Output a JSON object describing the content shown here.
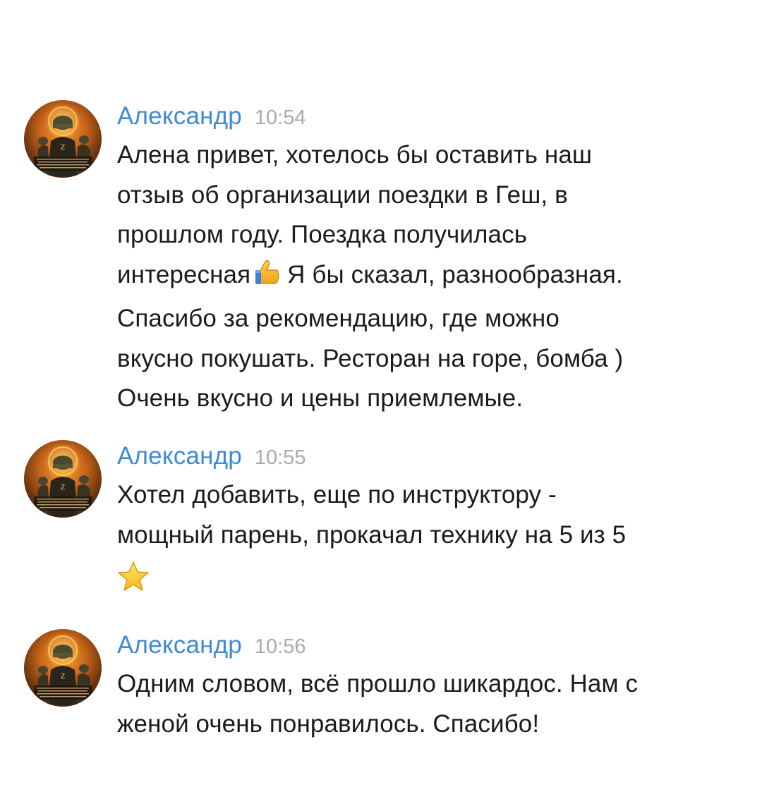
{
  "messages": [
    {
      "author": "Александр",
      "time": "10:54",
      "lines": [
        [
          "Алена привет, хотелось бы оставить наш"
        ],
        [
          "отзыв об организации поездки в Геш, в"
        ],
        [
          "прошлом году. Поездка получилась"
        ],
        [
          "интересная",
          "Я бы сказал, разнообразная."
        ],
        [
          "Спасибо за рекомендацию, где можно"
        ],
        [
          "вкусно покушать. Ресторан на горе, бомба )"
        ],
        [
          "Очень вкусно и цены приемлемые."
        ]
      ],
      "emoji": "thumbs-up-icon"
    },
    {
      "author": "Александр",
      "time": "10:55",
      "lines": [
        [
          "Хотел добавить, еще по инструктору -"
        ],
        [
          "мощный парень, прокачал технику на 5 из 5"
        ]
      ],
      "emoji": "star-icon"
    },
    {
      "author": "Александр",
      "time": "10:56",
      "lines": [
        [
          "Одним словом, всё прошло шикардос. Нам с"
        ],
        [
          "женой очень понравилось. Спасибо!"
        ]
      ]
    }
  ],
  "colors": {
    "author": "#3f8ad6",
    "time": "#a6abb2",
    "text": "#1b1b1b",
    "background": "#ffffff"
  }
}
